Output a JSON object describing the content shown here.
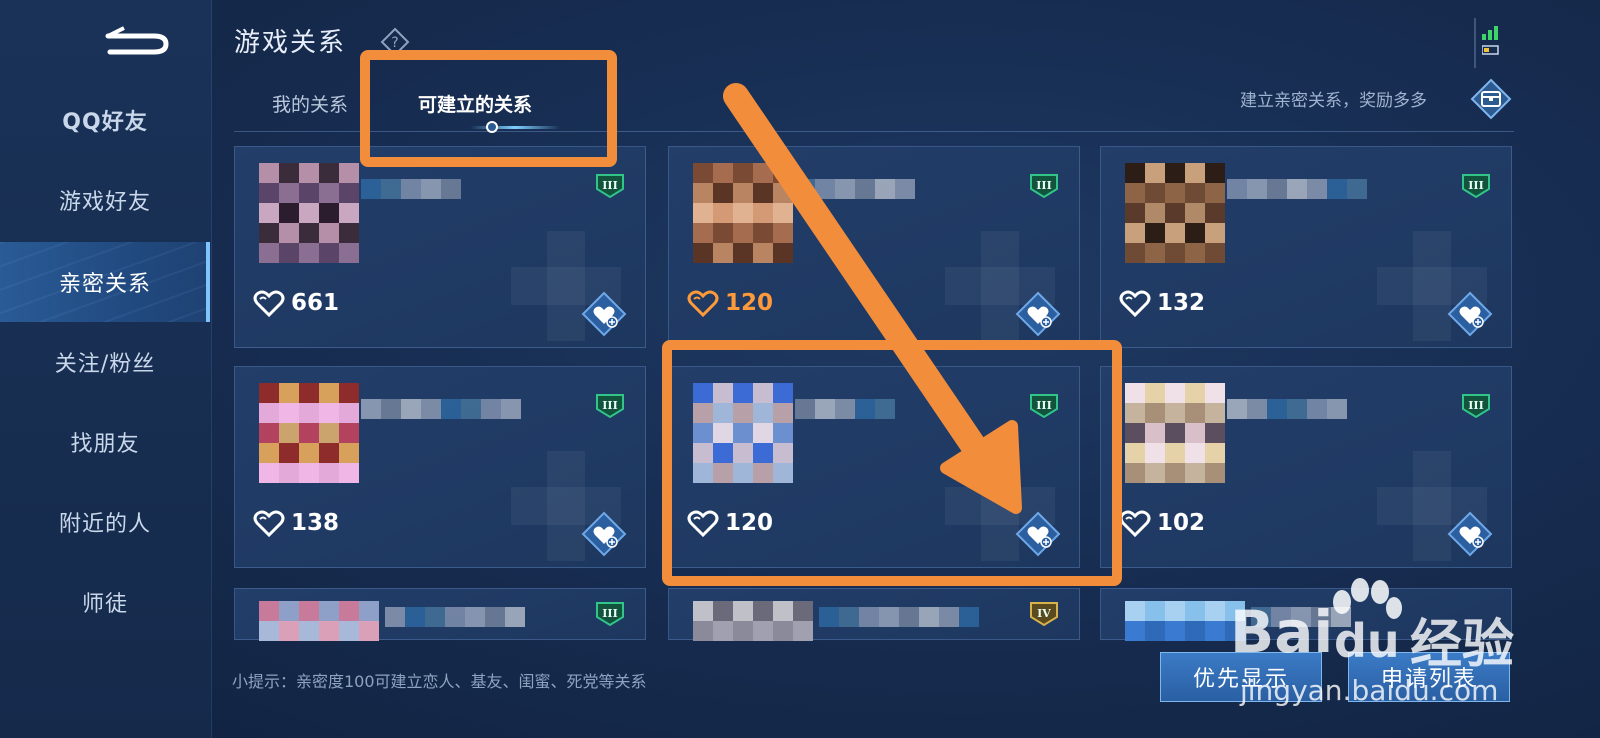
{
  "sidebar": {
    "items": [
      {
        "label": "QQ好友"
      },
      {
        "label": "游戏好友"
      },
      {
        "label": "亲密关系"
      },
      {
        "label": "关注/粉丝"
      },
      {
        "label": "找朋友"
      },
      {
        "label": "附近的人"
      },
      {
        "label": "师徒"
      }
    ],
    "active_index": 2
  },
  "header": {
    "title": "游戏关系",
    "help_icon": "question-diamond-icon",
    "tabs": [
      {
        "label": "我的关系"
      },
      {
        "label": "可建立的关系"
      }
    ],
    "active_tab": 1,
    "reward_text": "建立亲密关系，奖励多多"
  },
  "cards": [
    {
      "intimacy": "661",
      "rank": "III",
      "highlight": false
    },
    {
      "intimacy": "120",
      "rank": "III",
      "highlight": true
    },
    {
      "intimacy": "132",
      "rank": "III",
      "highlight": false
    },
    {
      "intimacy": "138",
      "rank": "III",
      "highlight": false
    },
    {
      "intimacy": "120",
      "rank": "III",
      "highlight": false
    },
    {
      "intimacy": "102",
      "rank": "III",
      "highlight": false
    },
    {
      "rank": "III"
    },
    {
      "rank": "IV"
    },
    {
      "rank": ""
    }
  ],
  "footer": {
    "tip": "小提示：亲密度100可建立恋人、基友、闺蜜、死党等关系",
    "priority_button": "优先显示",
    "requests_button": "申请列表"
  },
  "watermark": {
    "brand_left": "Bai",
    "brand_mid": "du",
    "brand_right": "经验",
    "url": "jingyan.baidu.com"
  },
  "colors": {
    "annotation": "#f28d3b",
    "accent_orange": "#ff9a3a",
    "rank_green": "#33c48a"
  }
}
